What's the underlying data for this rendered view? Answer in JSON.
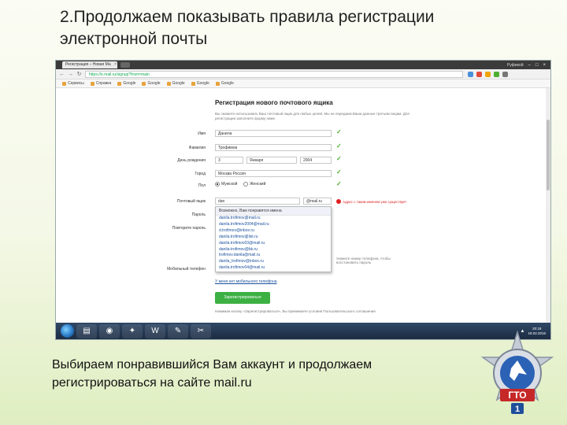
{
  "slide": {
    "title_line1": "2.Продолжаем показывать правила регистрации",
    "title_line2": "электронной  почты",
    "caption_line1": "Выбираем понравившийся Вам аккаунт и продолжаем",
    "caption_line2": "регистрироваться на сайте mail.ru",
    "emblem_text": "ГТО",
    "emblem_number": "1"
  },
  "browser": {
    "tab_title": "Регистрация – Новая Ма",
    "profile_name": "Руфикой",
    "url": "https://e.mail.ru/signup?from=main",
    "bookmarks": [
      "Сервисы",
      "Справка",
      "Google",
      "Google",
      "Google",
      "Google",
      "Google"
    ]
  },
  "form": {
    "title": "Регистрация нового почтового ящика",
    "intro": "Вы сможете использовать Ваш почтовый ящик для любых целей. Мы не передаем Ваши данные третьим лицам. Для регистрации заполните форму ниже.",
    "labels": {
      "first_name": "Имя",
      "last_name": "Фамилия",
      "birthday": "День рождения",
      "city": "Город",
      "gender": "Пол",
      "email": "Почтовый ящик",
      "password": "Пароль",
      "password_repeat": "Повторите пароль",
      "phone": "Мобильный телефон"
    },
    "values": {
      "first_name": "Данила",
      "last_name": "Трофимов",
      "day": "3",
      "month": "Января",
      "year": "2004",
      "city": "Москва Россия",
      "email": "dan",
      "domain": "@mail.ru"
    },
    "gender_options": [
      "Мужской",
      "Женский"
    ],
    "email_warning": "Адрес с таким именем уже существует",
    "dropdown_header": "Возможно, Вам понравятся имена",
    "suggestions": [
      "danila.trofimov@mail.ru",
      "danila.trofimov2004@mail.ru",
      "d.trofimov@inbox.ru",
      "danila.trofimov@list.ru",
      "danila.trofimov03@mail.ru",
      "danila-trofimov@bk.ru",
      "trofimov.danila@mail.ru",
      "danila_trofimov@inbox.ru",
      "danila.trofimov04@mail.ru"
    ],
    "phone_hint": "Укажите номер телефона, чтобы восстановить пароль",
    "no_phone_link": "У меня нет мобильного телефона",
    "submit_label": "Зарегистрироваться",
    "terms": "Нажимая кнопку «Зарегистрироваться», Вы принимаете условия Пользовательского соглашения"
  },
  "taskbar": {
    "time": "20:18",
    "date": "18.02.2016"
  },
  "colors": {
    "accent_green": "#3cb043",
    "link_blue": "#1a4f9c",
    "warning_red": "#d22222"
  }
}
